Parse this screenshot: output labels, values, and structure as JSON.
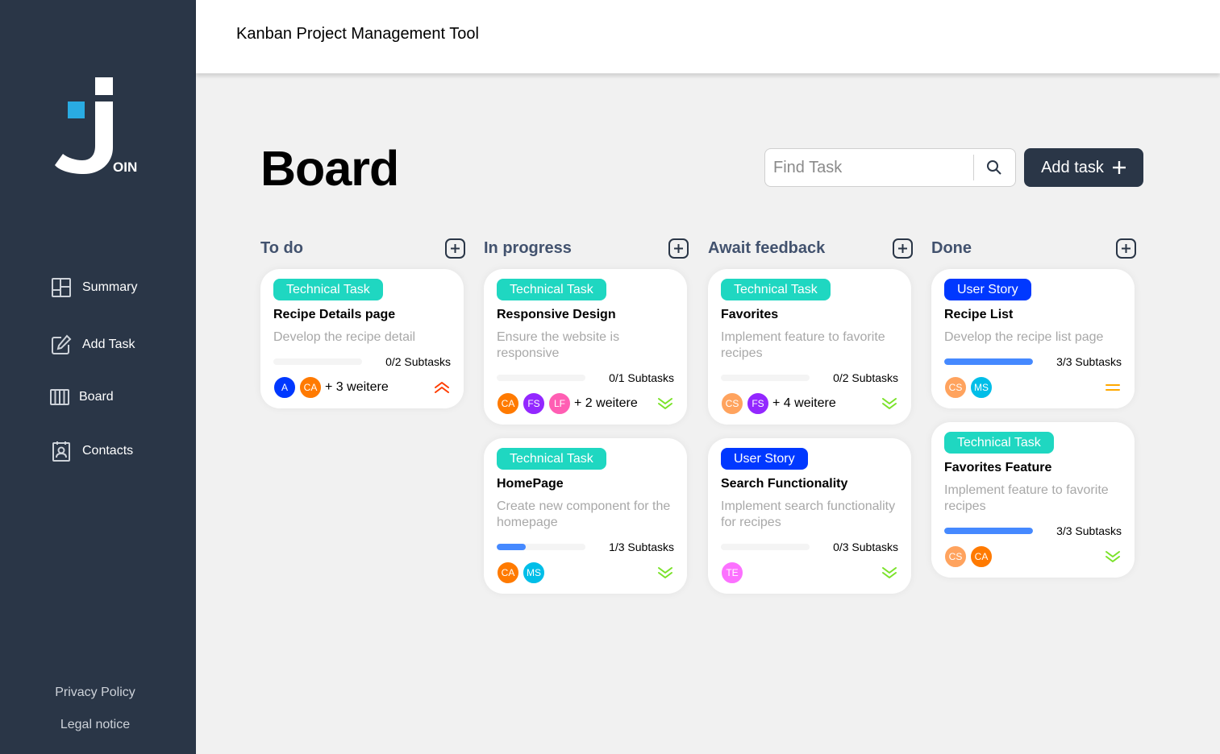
{
  "app": {
    "title": "Kanban Project Management Tool",
    "logo_text": "OIN"
  },
  "sidebar": {
    "items": [
      {
        "label": "Summary",
        "icon": "summary-icon"
      },
      {
        "label": "Add Task",
        "icon": "edit-icon"
      },
      {
        "label": "Board",
        "icon": "board-icon"
      },
      {
        "label": "Contacts",
        "icon": "contacts-icon"
      }
    ],
    "footer": {
      "privacy": "Privacy Policy",
      "legal": "Legal notice"
    }
  },
  "board": {
    "title": "Board",
    "search_placeholder": "Find Task",
    "add_task_label": "Add task"
  },
  "colors": {
    "sidebar": "#2a3647",
    "technical_task": "#1fd7c1",
    "user_story": "#0038ff",
    "progress": "#4589ff",
    "prio_urgent": "#ff3d00",
    "prio_medium": "#ffa800",
    "prio_low": "#7ae229"
  },
  "columns": [
    {
      "title": "To do",
      "cards": [
        {
          "category": "Technical Task",
          "title": "Recipe Details page",
          "description": "Develop the recipe detail",
          "progress": 0,
          "subtasks": "0/2 Subtasks",
          "avatars": [
            {
              "initials": "A",
              "color": "#0038ff"
            },
            {
              "initials": "CA",
              "color": "#ff7a00"
            }
          ],
          "more": "+ 3 weitere",
          "priority": "urgent"
        }
      ]
    },
    {
      "title": "In progress",
      "cards": [
        {
          "category": "Technical Task",
          "title": "Responsive Design",
          "description": "Ensure the website is responsive",
          "progress": 0,
          "subtasks": "0/1 Subtasks",
          "avatars": [
            {
              "initials": "CA",
              "color": "#ff7a00"
            },
            {
              "initials": "FS",
              "color": "#9327ff"
            },
            {
              "initials": "LF",
              "color": "#ff5eb3"
            }
          ],
          "more": "+ 2 weitere",
          "priority": "low"
        },
        {
          "category": "Technical Task",
          "title": "HomePage",
          "description": "Create new component for the homepage",
          "progress": 0.33,
          "subtasks": "1/3 Subtasks",
          "avatars": [
            {
              "initials": "CA",
              "color": "#ff7a00"
            },
            {
              "initials": "MS",
              "color": "#00bee8"
            }
          ],
          "more": "",
          "priority": "low"
        }
      ]
    },
    {
      "title": "Await feedback",
      "cards": [
        {
          "category": "Technical Task",
          "title": "Favorites",
          "description": "Implement feature to favorite recipes",
          "progress": 0,
          "subtasks": "0/2 Subtasks",
          "avatars": [
            {
              "initials": "CS",
              "color": "#ffa35e"
            },
            {
              "initials": "FS",
              "color": "#9327ff"
            }
          ],
          "more": "+ 4 weitere",
          "priority": "low"
        },
        {
          "category": "User Story",
          "title": "Search Functionality",
          "description": "Implement search functionality for recipes",
          "progress": 0,
          "subtasks": "0/3 Subtasks",
          "avatars": [
            {
              "initials": "TE",
              "color": "#fc71ff"
            }
          ],
          "more": "",
          "priority": "low"
        }
      ]
    },
    {
      "title": "Done",
      "cards": [
        {
          "category": "User Story",
          "title": "Recipe List",
          "description": "Develop the recipe list page",
          "progress": 1,
          "subtasks": "3/3 Subtasks",
          "avatars": [
            {
              "initials": "CS",
              "color": "#ffa35e"
            },
            {
              "initials": "MS",
              "color": "#00bee8"
            }
          ],
          "more": "",
          "priority": "medium"
        },
        {
          "category": "Technical Task",
          "title": "Favorites Feature",
          "description": "Implement feature to favorite recipes",
          "progress": 1,
          "subtasks": "3/3 Subtasks",
          "avatars": [
            {
              "initials": "CS",
              "color": "#ffa35e"
            },
            {
              "initials": "CA",
              "color": "#ff7a00"
            }
          ],
          "more": "",
          "priority": "low"
        }
      ]
    }
  ]
}
